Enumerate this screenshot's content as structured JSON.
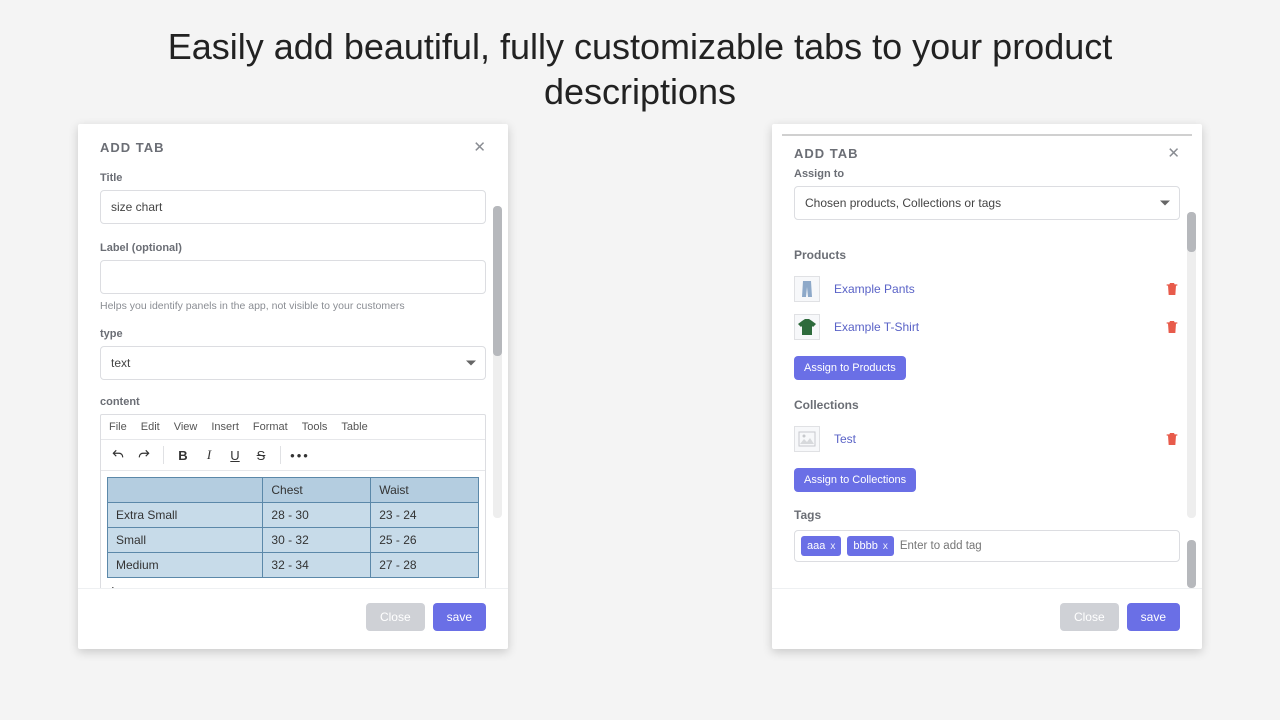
{
  "headline": "Easily add beautiful, fully customizable tabs to your product descriptions",
  "common": {
    "modal_title": "ADD TAB",
    "close_label": "Close",
    "save_label": "save"
  },
  "editor_menu": [
    "File",
    "Edit",
    "View",
    "Insert",
    "Format",
    "Tools",
    "Table"
  ],
  "left": {
    "title_label": "Title",
    "title_value": "size chart",
    "label_label": "Label (optional)",
    "label_value": "",
    "label_helper": "Helps you identify panels in the app, not visible to your customers",
    "type_label": "type",
    "type_value": "text",
    "content_label": "content",
    "size_table": {
      "columns": [
        "",
        "Chest",
        "Waist"
      ],
      "rows": [
        [
          "Extra Small",
          "28 - 30",
          "23 - 24"
        ],
        [
          "Small",
          "30 - 32",
          "25 - 26"
        ],
        [
          "Medium",
          "32 - 34",
          "27 - 28"
        ]
      ]
    },
    "cursor_char": "|"
  },
  "right": {
    "assign_label": "Assign to",
    "assign_value": "Chosen products, Collections or tags",
    "products_heading": "Products",
    "products": [
      {
        "name": "Example Pants",
        "icon": "pants"
      },
      {
        "name": "Example T-Shirt",
        "icon": "tshirt"
      }
    ],
    "assign_products_btn": "Assign to Products",
    "collections_heading": "Collections",
    "collections": [
      {
        "name": "Test",
        "icon": "placeholder"
      }
    ],
    "assign_collections_btn": "Assign to Collections",
    "tags_heading": "Tags",
    "tags": [
      "aaa",
      "bbbb"
    ],
    "tag_placeholder": "Enter to add tag",
    "tag_remove_label": "x"
  }
}
